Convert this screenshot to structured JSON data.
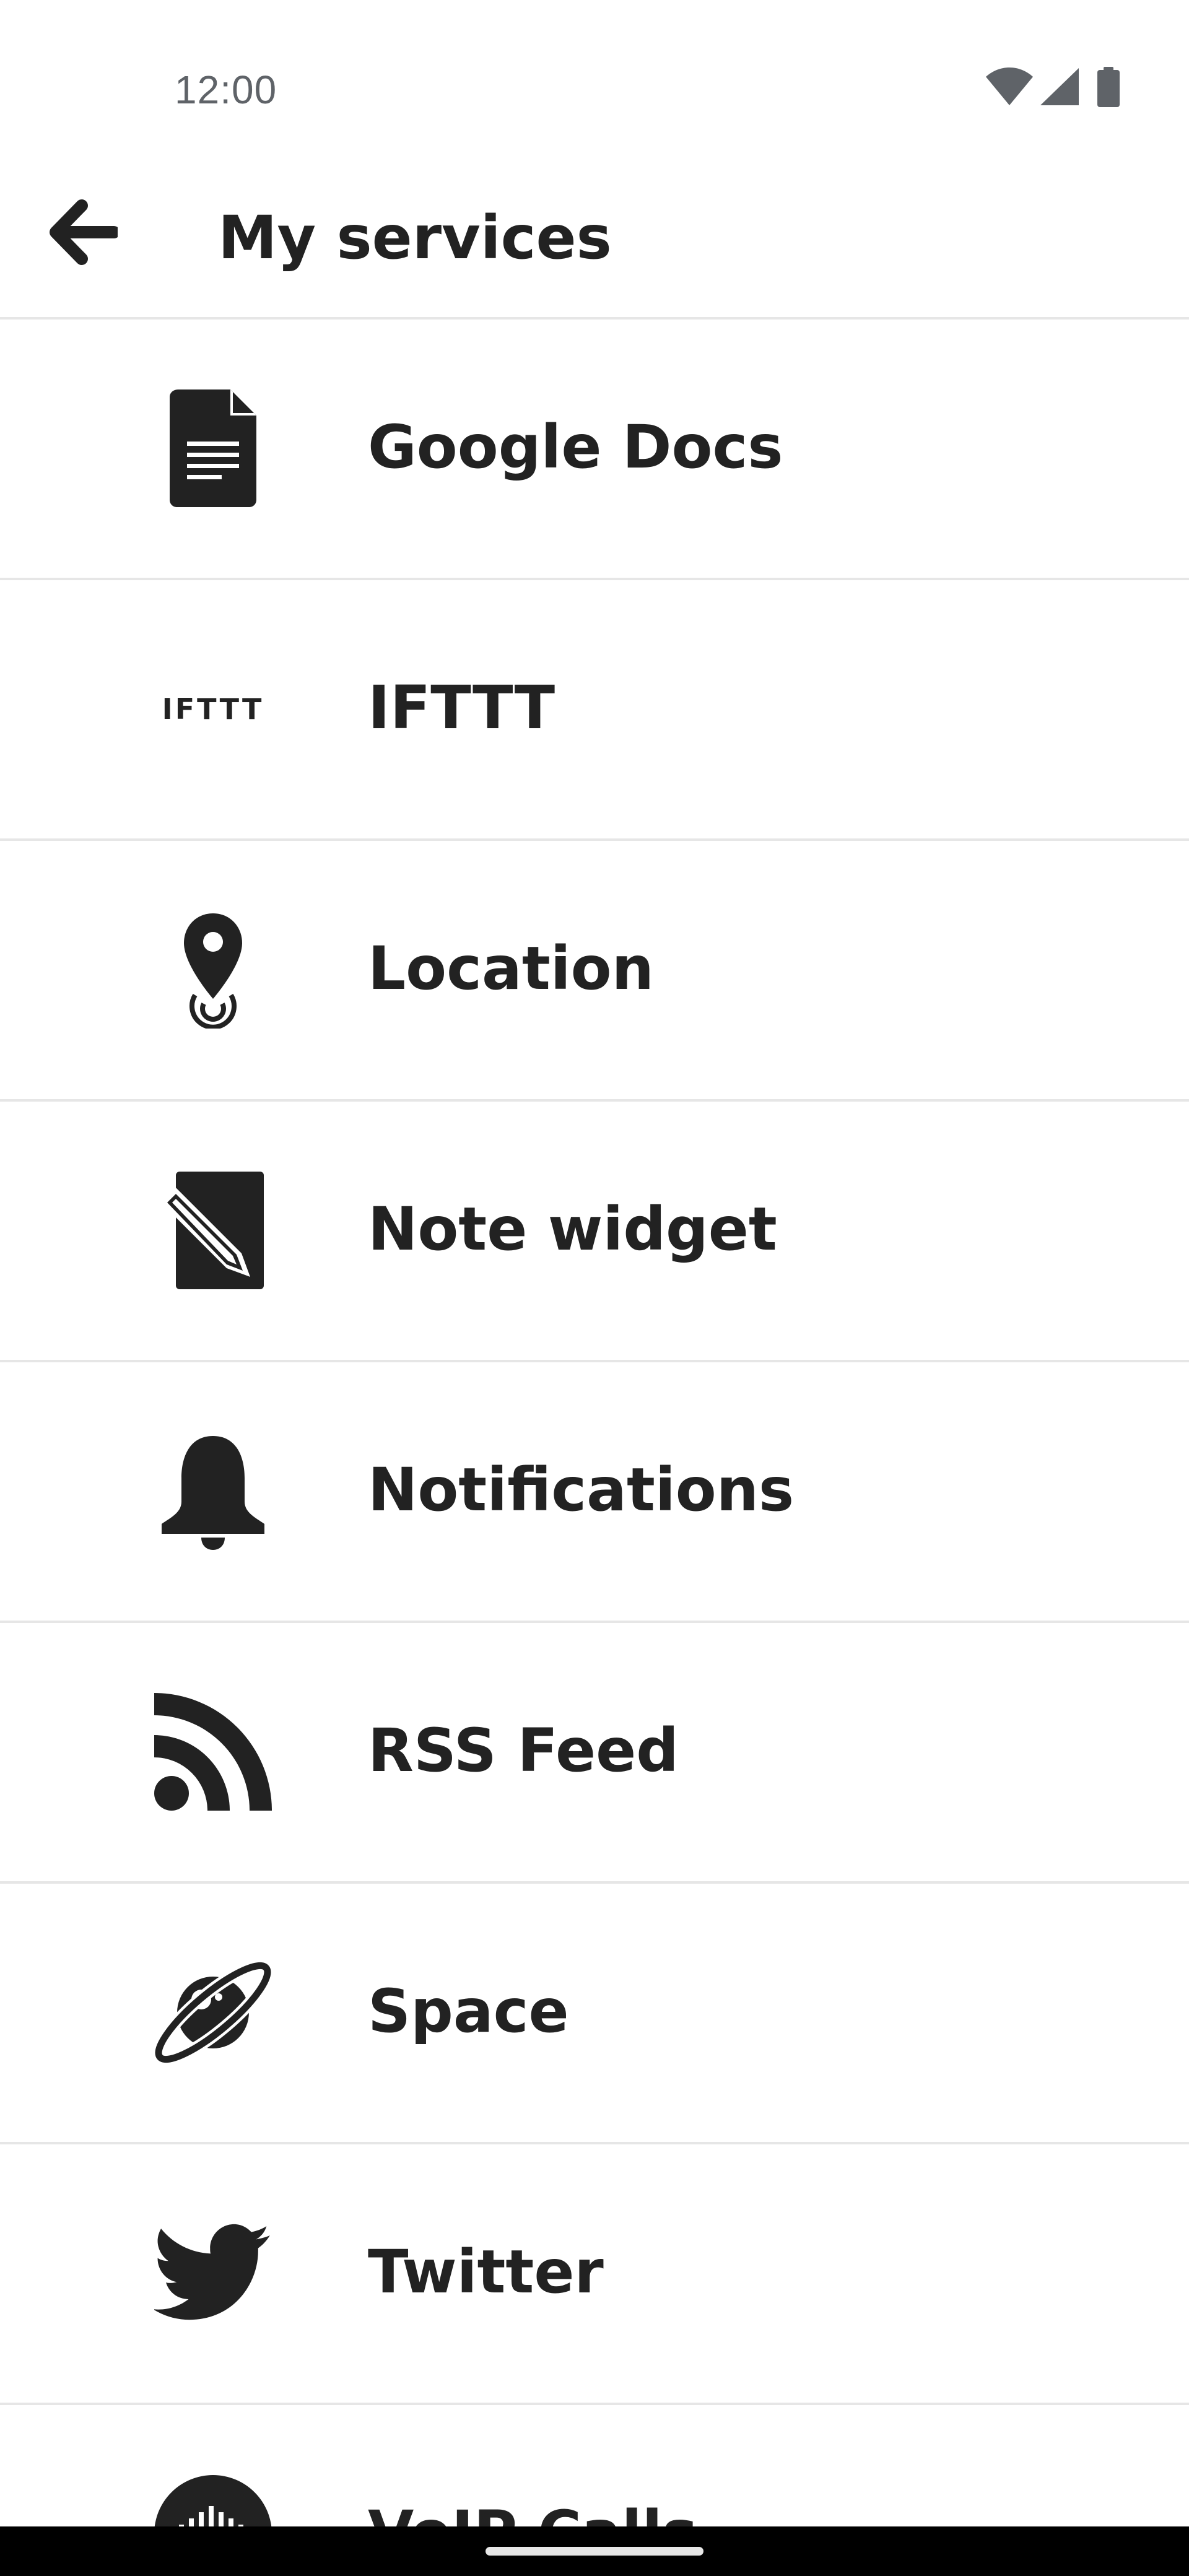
{
  "status_bar": {
    "time": "12:00",
    "icons": [
      "wifi-icon",
      "cellular-signal-icon",
      "battery-icon"
    ]
  },
  "app_bar": {
    "back_icon": "arrow-left-icon",
    "title": "My services"
  },
  "services": [
    {
      "label": "Google Docs",
      "icon": "google-docs-icon"
    },
    {
      "label": "IFTTT",
      "icon": "ifttt-logo-icon",
      "wordmark": "IFTTT"
    },
    {
      "label": "Location",
      "icon": "location-pin-icon"
    },
    {
      "label": "Note widget",
      "icon": "note-widget-icon"
    },
    {
      "label": "Notifications",
      "icon": "bell-icon"
    },
    {
      "label": "RSS Feed",
      "icon": "rss-icon"
    },
    {
      "label": "Space",
      "icon": "planet-icon"
    },
    {
      "label": "Twitter",
      "icon": "twitter-bird-icon"
    },
    {
      "label": "VoIP Calls",
      "icon": "voip-calls-icon"
    }
  ],
  "colors": {
    "text": "#222222",
    "status_text": "#5f6368",
    "divider": "#e6e6e6",
    "background": "#ffffff",
    "nav_bar": "#000000"
  }
}
